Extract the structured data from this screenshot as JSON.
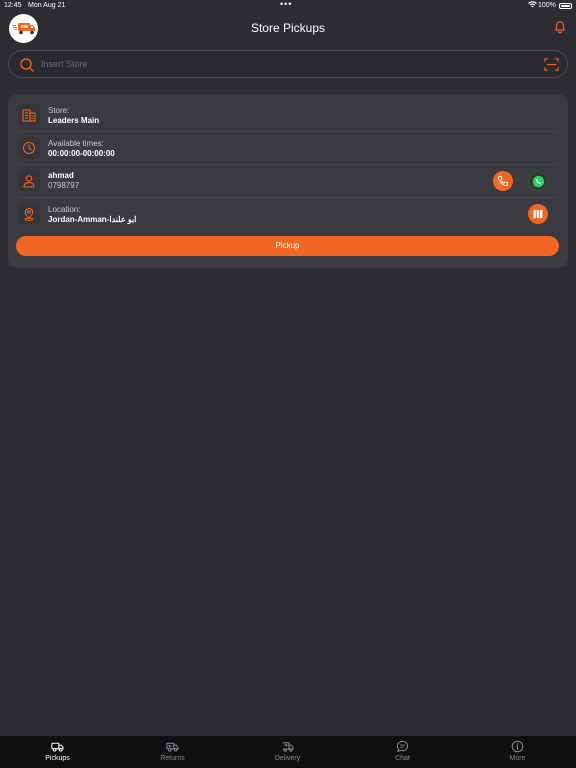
{
  "status_bar": {
    "time": "12:45",
    "date": "Mon Aug 21",
    "battery": "100%"
  },
  "header": {
    "title": "Store Pickups"
  },
  "search": {
    "placeholder": "Insert Store",
    "value": ""
  },
  "pickup_card": {
    "store_label": "Store:",
    "store_name": "Leaders Main",
    "times_label": "Available times:",
    "times_value": "00:00:00-00:00:00",
    "customer_name": "ahmad",
    "customer_phone": "0798797",
    "location_label": "Location:",
    "location_value": "Jordan-Amman-ابو علندا",
    "pickup_button": "Pickup"
  },
  "tabs": [
    {
      "label": "Pickups",
      "icon": "truck-icon",
      "active": true
    },
    {
      "label": "Returns",
      "icon": "return-truck-icon",
      "active": false
    },
    {
      "label": "Delivery",
      "icon": "delivery-truck-icon",
      "active": false
    },
    {
      "label": "Chat",
      "icon": "chat-icon",
      "active": false
    },
    {
      "label": "More",
      "icon": "info-icon",
      "active": false
    }
  ],
  "colors": {
    "background": "#2d2d33",
    "card": "#3a3a41",
    "accent": "#f26522",
    "tabbar": "#101012"
  }
}
